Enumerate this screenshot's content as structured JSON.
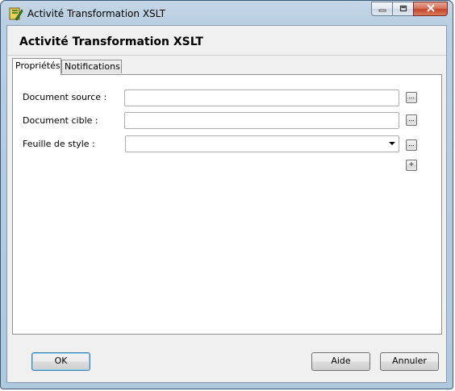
{
  "window": {
    "title": "Activité Transformation XSLT",
    "caption_buttons": [
      "minimize-icon",
      "maximize-icon",
      "close-icon"
    ]
  },
  "header": {
    "title": "Activité Transformation XSLT"
  },
  "tabs": [
    {
      "label": "Propriétés",
      "active": true
    },
    {
      "label": "Notifications",
      "active": false
    }
  ],
  "form": {
    "source_label": "Document source :",
    "source_value": "",
    "target_label": "Document cible :",
    "target_value": "",
    "stylesheet_label": "Feuille de style :",
    "stylesheet_value": "",
    "browse_label": "...",
    "add_label": "+"
  },
  "footer": {
    "ok": "OK",
    "help": "Aide",
    "cancel": "Annuler"
  },
  "colors": {
    "frame": "#b9cfe2",
    "client": "#f0f0f0",
    "close_button": "#c4452a"
  }
}
